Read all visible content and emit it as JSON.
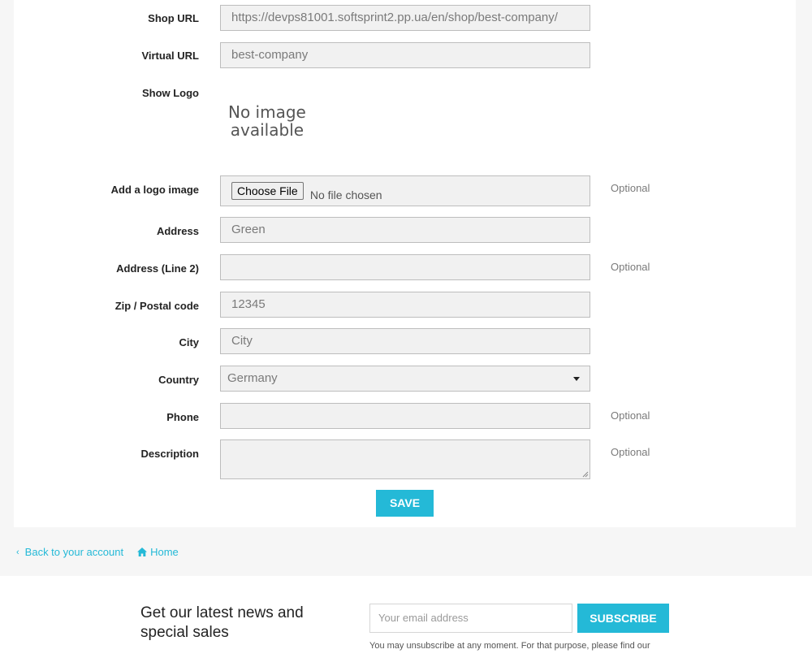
{
  "form": {
    "shop_url": {
      "label": "Shop URL",
      "value": "https://devps81001.softsprint2.pp.ua/en/shop/best-company/"
    },
    "virtual_url": {
      "label": "Virtual URL",
      "value": "best-company"
    },
    "show_logo": {
      "label": "Show Logo",
      "no_image_line1": "No image",
      "no_image_line2": "available"
    },
    "logo_image": {
      "label": "Add a logo image",
      "button": "Choose File",
      "status": "No file chosen",
      "optional": "Optional"
    },
    "address": {
      "label": "Address",
      "value": "Green"
    },
    "address2": {
      "label": "Address (Line 2)",
      "value": "",
      "optional": "Optional"
    },
    "zip": {
      "label": "Zip / Postal code",
      "value": "12345"
    },
    "city": {
      "label": "City",
      "value": "City"
    },
    "country": {
      "label": "Country",
      "value": "Germany"
    },
    "phone": {
      "label": "Phone",
      "value": "",
      "optional": "Optional"
    },
    "description": {
      "label": "Description",
      "value": "",
      "optional": "Optional"
    },
    "save_label": "SAVE"
  },
  "nav": {
    "back_label": "Back to your account",
    "home_label": "Home"
  },
  "newsletter": {
    "heading": "Get our latest news and special sales",
    "email_placeholder": "Your email address",
    "subscribe_label": "SUBSCRIBE",
    "note": "You may unsubscribe at any moment. For that purpose, please find our"
  },
  "colors": {
    "accent": "#24b9d7"
  }
}
